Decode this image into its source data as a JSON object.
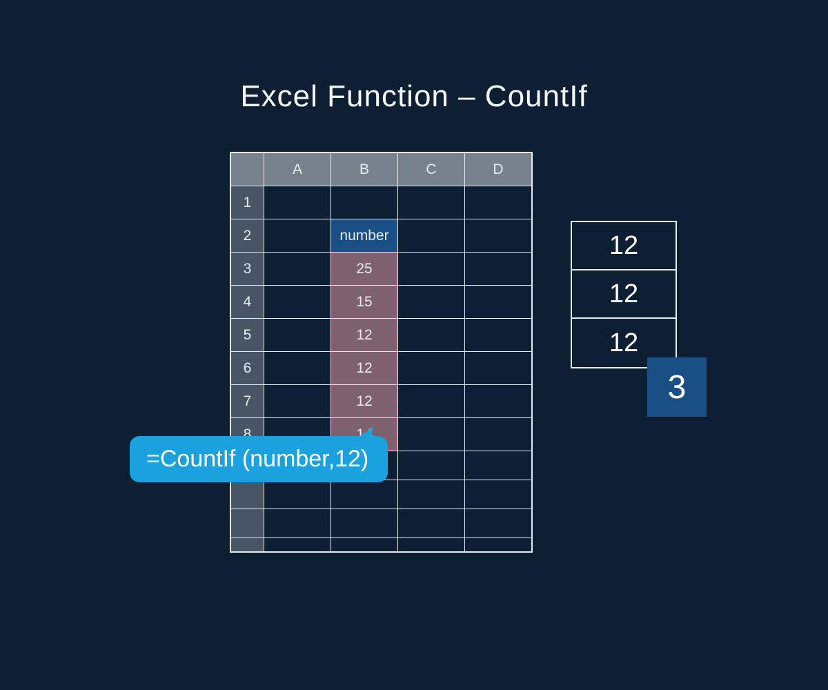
{
  "title": "Excel Function – CountIf",
  "sheet": {
    "columns": [
      "A",
      "B",
      "C",
      "D"
    ],
    "row_labels": [
      "1",
      "2",
      "3",
      "4",
      "5",
      "6",
      "7",
      "8"
    ],
    "named_range_label": "number",
    "values": [
      "25",
      "15",
      "12",
      "12",
      "12",
      "14"
    ]
  },
  "formula": "=CountIf (number,12)",
  "results": {
    "matches": [
      "12",
      "12",
      "12"
    ],
    "count": "3"
  },
  "chart_data": {
    "type": "table",
    "title": "Excel Function – CountIf",
    "series": [
      {
        "name": "number",
        "values": [
          25,
          15,
          12,
          12,
          12,
          14
        ]
      }
    ],
    "annotation": "=CountIf(number,12)",
    "result": 3
  }
}
